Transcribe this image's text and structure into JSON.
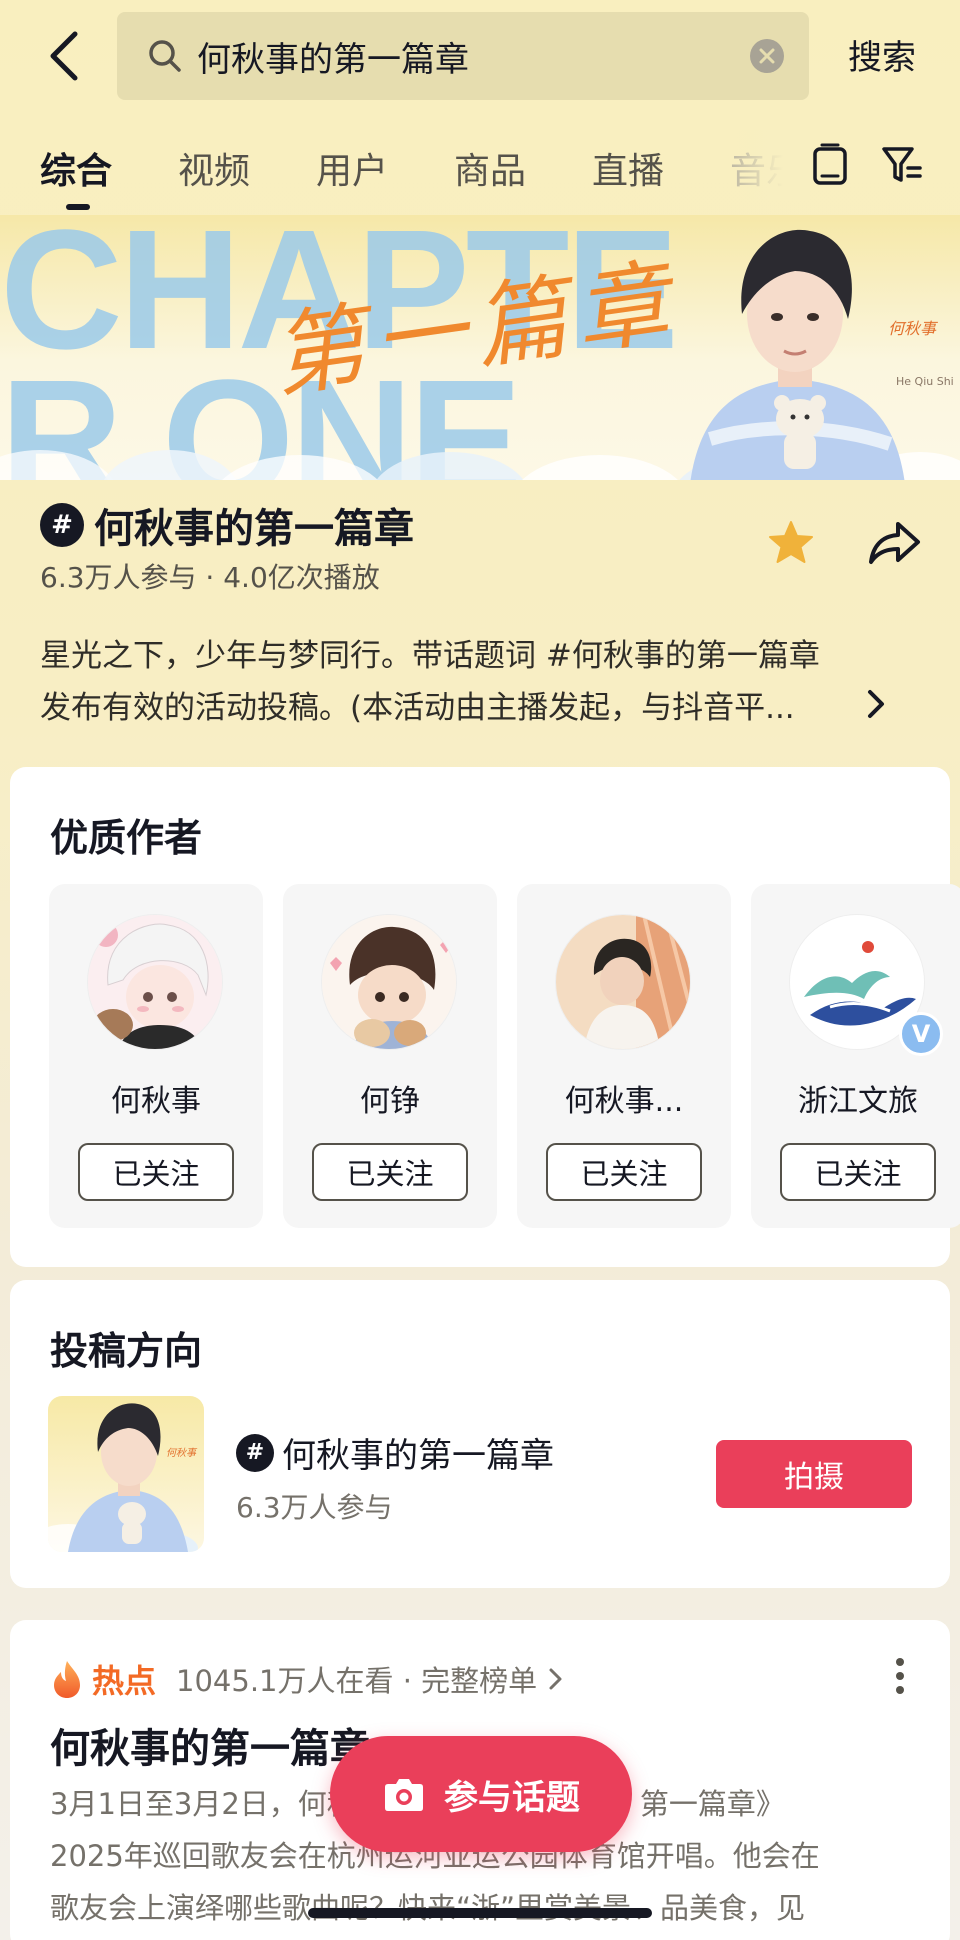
{
  "search": {
    "query": "何秋事的第一篇章",
    "submit_label": "搜索"
  },
  "tabs": [
    {
      "label": "综合",
      "active": true
    },
    {
      "label": "视频",
      "active": false
    },
    {
      "label": "用户",
      "active": false
    },
    {
      "label": "商品",
      "active": false
    },
    {
      "label": "直播",
      "active": false
    },
    {
      "label": "音乐",
      "active": false
    }
  ],
  "banner": {
    "big_text": "CHAPTER ONE",
    "calligraphy": "第一篇章",
    "signature": "何秋事",
    "signature_sub": "He Qiu Shi"
  },
  "topic": {
    "hash_symbol": "#",
    "title": "何秋事的第一篇章",
    "stats": "6.3万人参与 · 4.0亿次播放",
    "description_line1": "星光之下，少年与梦同行。带话题词 #何秋事的第一篇章",
    "description_line2": "发布有效的活动投稿。(本活动由主播发起，与抖音平..."
  },
  "authors_section": {
    "title": "优质作者",
    "authors": [
      {
        "name": "何秋事",
        "follow_label": "已关注"
      },
      {
        "name": "何铮",
        "follow_label": "已关注"
      },
      {
        "name": "何秋事...",
        "follow_label": "已关注"
      },
      {
        "name": "浙江文旅",
        "follow_label": "已关注",
        "verified_badge": "V"
      }
    ]
  },
  "direction_section": {
    "title": "投稿方向",
    "topic_title": "何秋事的第一篇章",
    "participants": "6.3万人参与",
    "shoot_label": "拍摄"
  },
  "hot_section": {
    "label": "热点",
    "meta": "1045.1万人在看 · 完整榜单",
    "title": "何秋事的第一篇章",
    "text_line1": "3月1日至3月2日，何秋事《CHAPTER ONE· 第一篇章》",
    "text_line2": "2025年巡回歌友会在杭州运河亚运公园体育馆开唱。他会在",
    "text_line3": "歌友会上演绎哪些歌曲呢？快来“浙”里赏美景、品美食，见"
  },
  "floating": {
    "join_label": "参与话题"
  },
  "colors": {
    "accent_red": "#ea3f5a",
    "hot_orange": "#f36a25",
    "star_gold": "#f0b23a",
    "page_bg": "#f8eec4"
  },
  "icons": {
    "back": "back-arrow-icon",
    "search": "search-icon",
    "clear": "clear-icon",
    "tablet": "tablet-icon",
    "filter": "filter-icon",
    "star": "star-icon",
    "share": "share-icon",
    "flame": "flame-icon",
    "camera": "camera-icon"
  }
}
